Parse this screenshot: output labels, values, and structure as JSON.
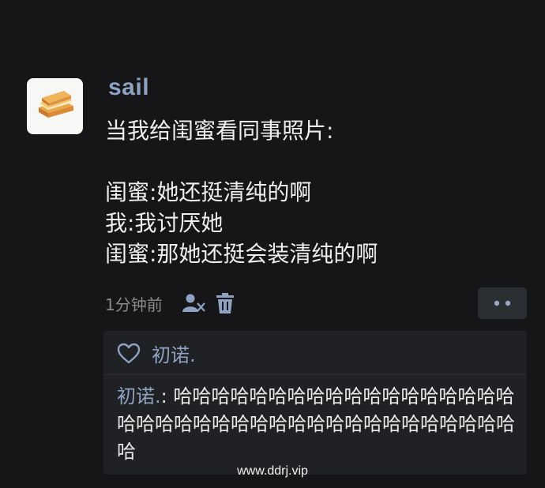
{
  "post": {
    "avatar_icon": "toast-sandwich-icon",
    "username": "sail",
    "lines": [
      "当我给闺蜜看同事照片:",
      "",
      "闺蜜:她还挺清纯的啊",
      "我:我讨厌她",
      "闺蜜:那她还挺会装清纯的啊"
    ],
    "timestamp": "1分钟前",
    "action_icons": [
      "user-visibility-icon",
      "trash-icon",
      "more-icon"
    ]
  },
  "likes": {
    "icon": "heart-outline-icon",
    "names": "初诺."
  },
  "comments": [
    {
      "author": "初诺.",
      "separator": ": ",
      "text": "哈哈哈哈哈哈哈哈哈哈哈哈哈哈哈哈哈哈哈哈哈哈哈哈哈哈哈哈哈哈哈哈哈哈哈哈哈哈哈哈"
    }
  ],
  "watermark": "www.ddrj.vip",
  "colors": {
    "background": "#161618",
    "username": "#8ea2c2",
    "comment_bg": "#202124",
    "more_button_bg": "#2b2e33"
  }
}
